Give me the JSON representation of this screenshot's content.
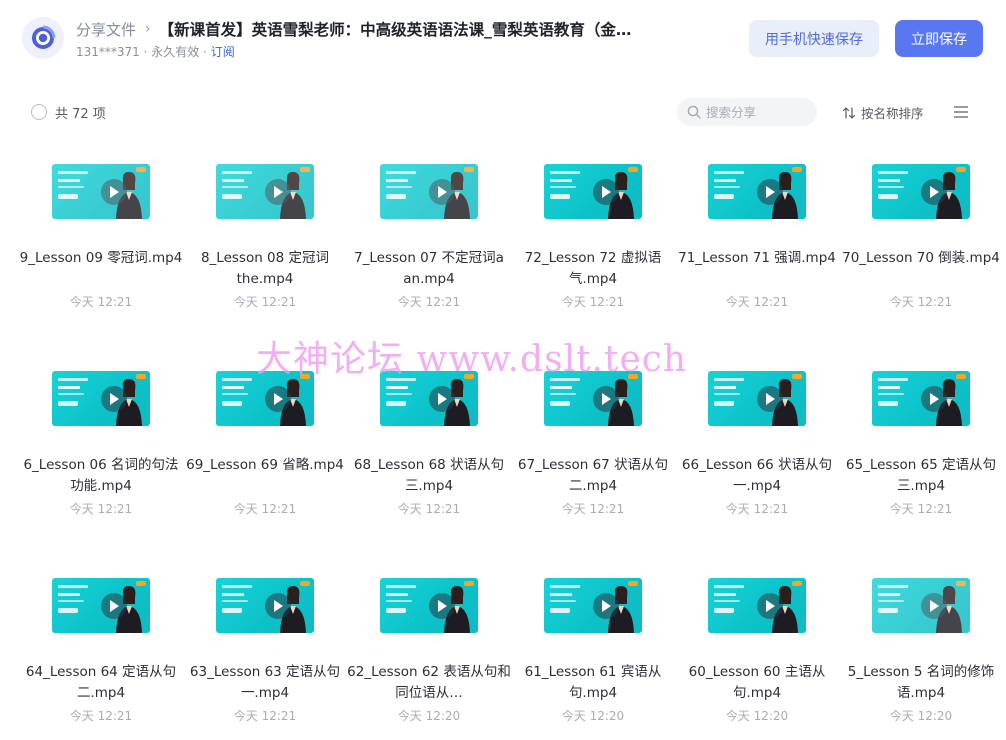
{
  "header": {
    "breadcrumb_root": "分享文件",
    "breadcrumb_sep": "›",
    "title": "【新课首发】英语雪梨老师：中高级英语语法课_雪梨英语教育（金…",
    "meta_user": "131***371 · 永久有效 · ",
    "meta_subscribe": "订阅",
    "phone_save_label": "用手机快速保存",
    "save_label": "立即保存"
  },
  "toolbar": {
    "count_label": "共 72 项",
    "search_placeholder": "搜索分享",
    "sort_label": "按名称排序"
  },
  "watermark": "大神论坛  www.dslt.tech",
  "files": [
    {
      "name": "9_Lesson 09 零冠词.mp4",
      "time": "今天 12:21",
      "variant": "faded"
    },
    {
      "name": "8_Lesson 08 定冠词 the.mp4",
      "time": "今天 12:21",
      "variant": "faded"
    },
    {
      "name": "7_Lesson 07 不定冠词a an.mp4",
      "time": "今天 12:21",
      "variant": "faded"
    },
    {
      "name": "72_Lesson 72 虚拟语气.mp4",
      "time": "今天 12:21",
      "variant": "normal"
    },
    {
      "name": "71_Lesson 71 强调.mp4",
      "time": "今天 12:21",
      "variant": "normal"
    },
    {
      "name": "70_Lesson 70 倒装.mp4",
      "time": "今天 12:21",
      "variant": "normal"
    },
    {
      "name": "6_Lesson 06 名词的句法功能.mp4",
      "time": "今天 12:21",
      "variant": "normal"
    },
    {
      "name": "69_Lesson 69 省略.mp4",
      "time": "今天 12:21",
      "variant": "normal"
    },
    {
      "name": "68_Lesson 68 状语从句 三.mp4",
      "time": "今天 12:21",
      "variant": "normal"
    },
    {
      "name": "67_Lesson 67 状语从句 二.mp4",
      "time": "今天 12:21",
      "variant": "normal"
    },
    {
      "name": "66_Lesson 66 状语从句 一.mp4",
      "time": "今天 12:21",
      "variant": "normal"
    },
    {
      "name": "65_Lesson 65 定语从句 三.mp4",
      "time": "今天 12:21",
      "variant": "normal"
    },
    {
      "name": "64_Lesson 64 定语从句 二.mp4",
      "time": "今天 12:21",
      "variant": "normal"
    },
    {
      "name": "63_Lesson 63 定语从句 一.mp4",
      "time": "今天 12:21",
      "variant": "normal"
    },
    {
      "name": "62_Lesson 62 表语从句和同位语从…",
      "time": "今天 12:20",
      "variant": "normal"
    },
    {
      "name": "61_Lesson 61 宾语从句.mp4",
      "time": "今天 12:20",
      "variant": "normal"
    },
    {
      "name": "60_Lesson 60 主语从句.mp4",
      "time": "今天 12:20",
      "variant": "normal"
    },
    {
      "name": "5_Lesson 5 名词的修饰语.mp4",
      "time": "今天 12:20",
      "variant": "faded"
    }
  ]
}
